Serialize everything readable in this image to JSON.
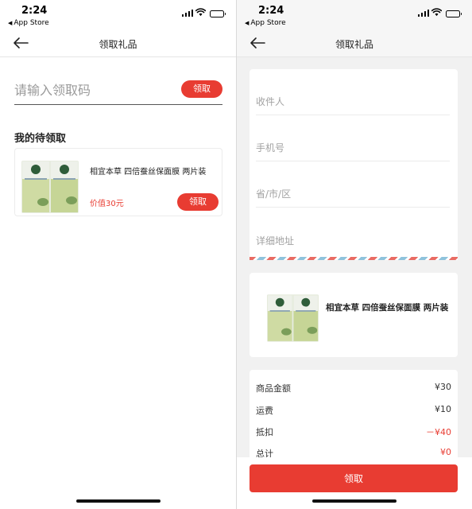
{
  "status_bar": {
    "time": "2:24",
    "back_label": "App Store",
    "back_icon": "triangle-left-icon",
    "icons": [
      "cellular-signal-icon",
      "wifi-icon",
      "battery-icon"
    ]
  },
  "left_screen": {
    "nav": {
      "title": "领取礼品",
      "back_icon": "arrow-left-icon"
    },
    "code_input": {
      "placeholder": "请输入领取码",
      "value": ""
    },
    "code_button_label": "领取",
    "section_title": "我的待领取",
    "pending_item": {
      "name": "相宜本草 四倍蚕丝保面膜 两片装",
      "value_text": "价值30元",
      "button_label": "领取"
    }
  },
  "right_screen": {
    "nav": {
      "title": "领取礼品",
      "back_icon": "arrow-left-icon"
    },
    "address_fields": [
      {
        "placeholder": "收件人",
        "value": ""
      },
      {
        "placeholder": "手机号",
        "value": ""
      },
      {
        "placeholder": "省/市/区",
        "value": ""
      },
      {
        "placeholder": "详细地址",
        "value": ""
      }
    ],
    "product": {
      "name": "相宜本草 四倍蚕丝保面膜 两片装"
    },
    "summary": [
      {
        "label": "商品金额",
        "value": "¥30"
      },
      {
        "label": "运费",
        "value": "¥10"
      },
      {
        "label": "抵扣",
        "value": "－¥40"
      },
      {
        "label": "总计",
        "value": "¥0"
      }
    ],
    "claim_button_label": "领取"
  },
  "colors": {
    "accent": "#e83c32",
    "page_background": "#f1f1f1",
    "product_green": "#c8d89a",
    "product_logo": "#2f5d3a"
  }
}
